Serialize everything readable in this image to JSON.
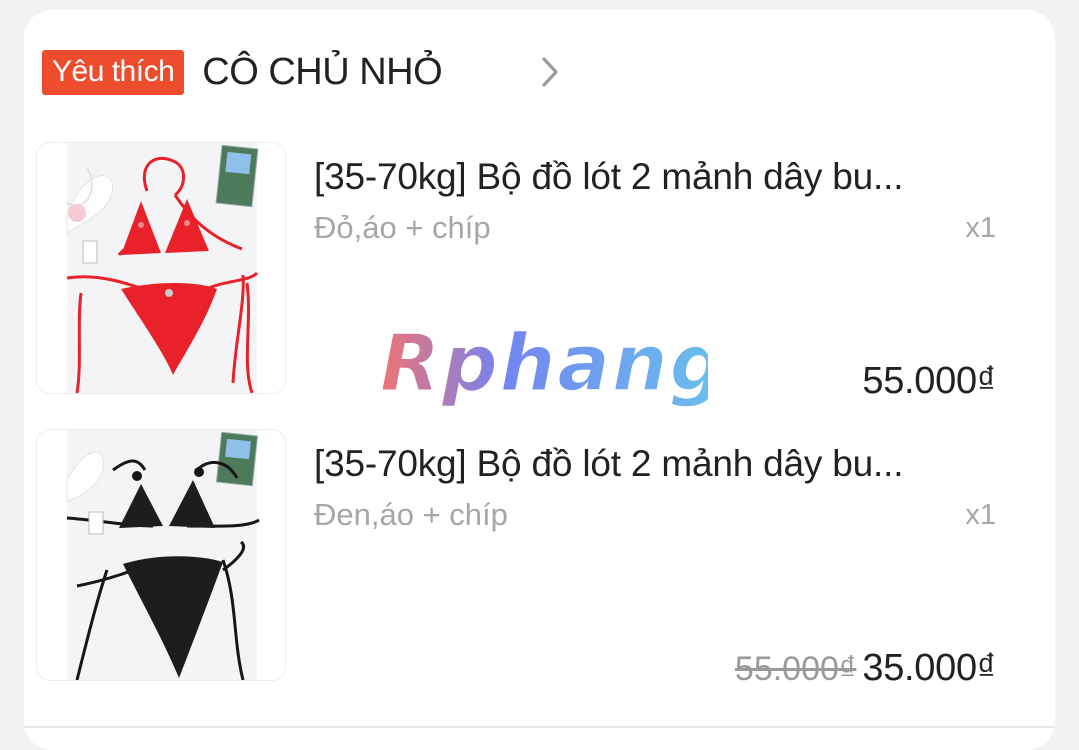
{
  "shop": {
    "badge": "Yêu thích",
    "name": "CÔ CHỦ NHỎ"
  },
  "items": [
    {
      "title": "[35-70kg] Bộ đồ lót 2 mảnh dây bu...",
      "variant": "Đỏ,áo + chíp",
      "quantity": "x1",
      "old_price": "",
      "price": "55.000₫",
      "product_color": "#e8212a"
    },
    {
      "title": "[35-70kg] Bộ đồ lót 2 mảnh dây bu...",
      "variant": "Đen,áo + chíp",
      "quantity": "x1",
      "old_price": "55.000₫",
      "price": "35.000₫",
      "product_color": "#161616"
    }
  ],
  "watermark": {
    "text": "Rphang"
  },
  "colors": {
    "accent": "#ee4d2d",
    "muted_text": "#a6a6a6"
  }
}
